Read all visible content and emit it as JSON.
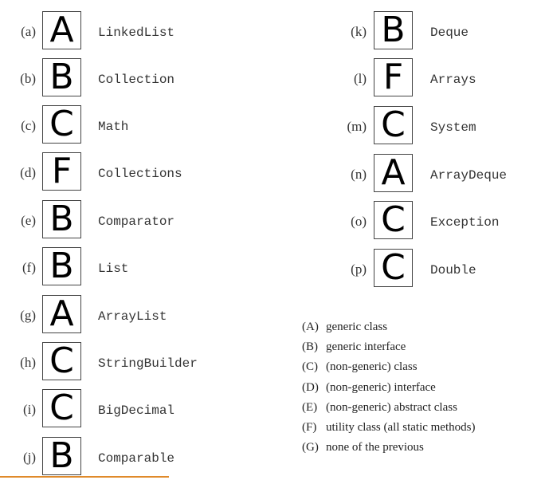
{
  "questions_left": [
    {
      "label": "(a)",
      "answer": "A",
      "name": "LinkedList"
    },
    {
      "label": "(b)",
      "answer": "B",
      "name": "Collection"
    },
    {
      "label": "(c)",
      "answer": "C",
      "name": "Math"
    },
    {
      "label": "(d)",
      "answer": "F",
      "name": "Collections"
    },
    {
      "label": "(e)",
      "answer": "B",
      "name": "Comparator"
    },
    {
      "label": "(f)",
      "answer": "B",
      "name": "List"
    },
    {
      "label": "(g)",
      "answer": "A",
      "name": "ArrayList"
    },
    {
      "label": "(h)",
      "answer": "C",
      "name": "StringBuilder"
    },
    {
      "label": "(i)",
      "answer": "C",
      "name": "BigDecimal"
    },
    {
      "label": "(j)",
      "answer": "B",
      "name": "Comparable"
    }
  ],
  "questions_right": [
    {
      "label": "(k)",
      "answer": "B",
      "name": "Deque"
    },
    {
      "label": "(l)",
      "answer": "F",
      "name": "Arrays"
    },
    {
      "label": "(m)",
      "answer": "C",
      "name": "System"
    },
    {
      "label": "(n)",
      "answer": "A",
      "name": "ArrayDeque"
    },
    {
      "label": "(o)",
      "answer": "C",
      "name": "Exception"
    },
    {
      "label": "(p)",
      "answer": "C",
      "name": "Double"
    }
  ],
  "legend": [
    {
      "key": "(A)",
      "text": "generic class"
    },
    {
      "key": "(B)",
      "text": "generic interface"
    },
    {
      "key": "(C)",
      "text": "(non-generic) class"
    },
    {
      "key": "(D)",
      "text": "(non-generic) interface"
    },
    {
      "key": "(E)",
      "text": "(non-generic) abstract class"
    },
    {
      "key": "(F)",
      "text": "utility class (all static methods)"
    },
    {
      "key": "(G)",
      "text": "none of the previous"
    }
  ],
  "colors": {
    "underline_accent": "#e08a2a"
  }
}
